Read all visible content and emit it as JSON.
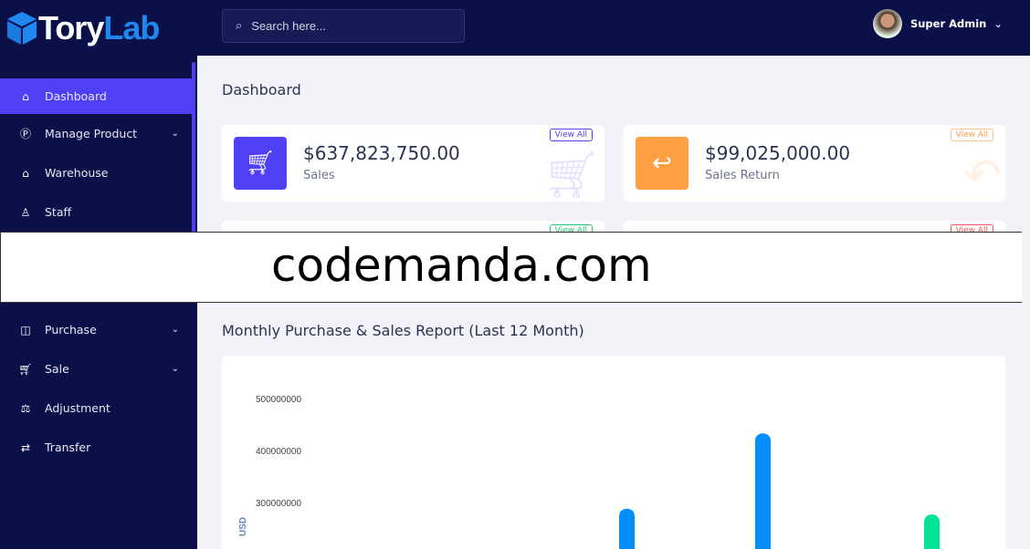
{
  "brand": {
    "part1": "Tory",
    "part2": "Lab"
  },
  "sidebar": {
    "items": [
      {
        "label": "Dashboard",
        "icon": "home-icon",
        "active": true
      },
      {
        "label": "Manage Product",
        "icon": "product-icon",
        "dropdown": true
      },
      {
        "label": "Warehouse",
        "icon": "warehouse-icon"
      },
      {
        "label": "Staff",
        "icon": "user-icon"
      },
      {
        "label": "Purchase",
        "icon": "bag-icon",
        "dropdown": true
      },
      {
        "label": "Sale",
        "icon": "cart-icon",
        "dropdown": true
      },
      {
        "label": "Adjustment",
        "icon": "scale-icon"
      },
      {
        "label": "Transfer",
        "icon": "transfer-icon"
      }
    ]
  },
  "search": {
    "placeholder": "Search here..."
  },
  "user": {
    "name": "Super Admin"
  },
  "page": {
    "title": "Dashboard"
  },
  "cards": [
    {
      "amount": "$637,823,750.00",
      "label": "Sales",
      "view": "View All",
      "color": "#4f3ff5"
    },
    {
      "amount": "$99,025,000.00",
      "label": "Sales Return",
      "view": "View All",
      "color": "#ff9f43"
    },
    {
      "view": "View All",
      "color": "#28c76f"
    },
    {
      "view": "View All",
      "color": "#ea5455"
    }
  ],
  "watermark": "codemanda.com",
  "chart_title": "Monthly Purchase & Sales Report (Last 12 Month)",
  "chart_data": {
    "type": "bar",
    "ylabel": "USD",
    "yticks": [
      "500000000",
      "400000000",
      "300000000"
    ],
    "series": [
      {
        "color": "#008ffb",
        "bars": [
          288000000,
          433000000
        ]
      },
      {
        "color": "#00e396",
        "bars": [
          277000000
        ]
      }
    ]
  }
}
